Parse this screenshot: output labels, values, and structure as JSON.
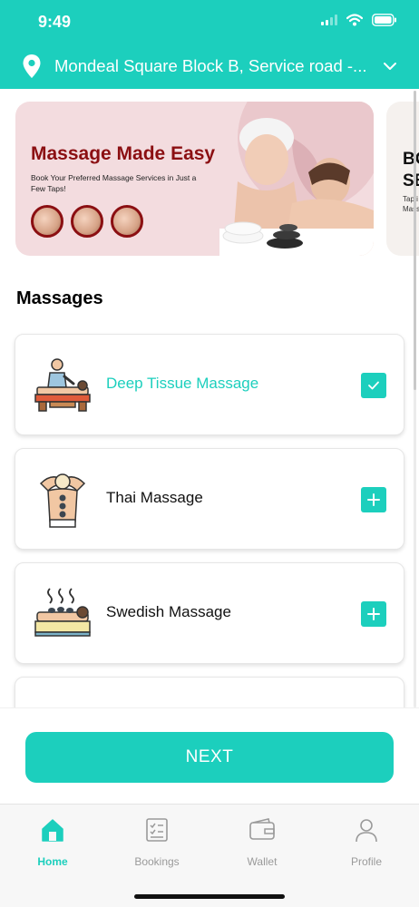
{
  "status_bar": {
    "time": "9:49"
  },
  "location": {
    "address": "Mondeal Square Block B, Service road -..."
  },
  "banners": [
    {
      "title": "Massage Made Easy",
      "subtitle": "Book Your Preferred Massage Services in Just a Few Taps!"
    },
    {
      "title_line1": "BO",
      "title_line2": "SE",
      "subtitle_line1": "Tap i",
      "subtitle_line2": "Mass"
    }
  ],
  "section": {
    "title": "Massages"
  },
  "massages": [
    {
      "name": "Deep Tissue Massage",
      "selected": true,
      "icon": "deep-tissue-massage-icon"
    },
    {
      "name": "Thai Massage",
      "selected": false,
      "icon": "thai-massage-icon"
    },
    {
      "name": "Swedish Massage",
      "selected": false,
      "icon": "swedish-massage-icon"
    }
  ],
  "next_button": {
    "label": "NEXT"
  },
  "tabs": [
    {
      "label": "Home",
      "icon": "home-icon",
      "active": true
    },
    {
      "label": "Bookings",
      "icon": "bookings-icon",
      "active": false
    },
    {
      "label": "Wallet",
      "icon": "wallet-icon",
      "active": false
    },
    {
      "label": "Profile",
      "icon": "profile-icon",
      "active": false
    }
  ],
  "colors": {
    "accent": "#1ccfbd",
    "banner_title": "#8b0f12",
    "inactive_tab": "#9a9a9a"
  }
}
